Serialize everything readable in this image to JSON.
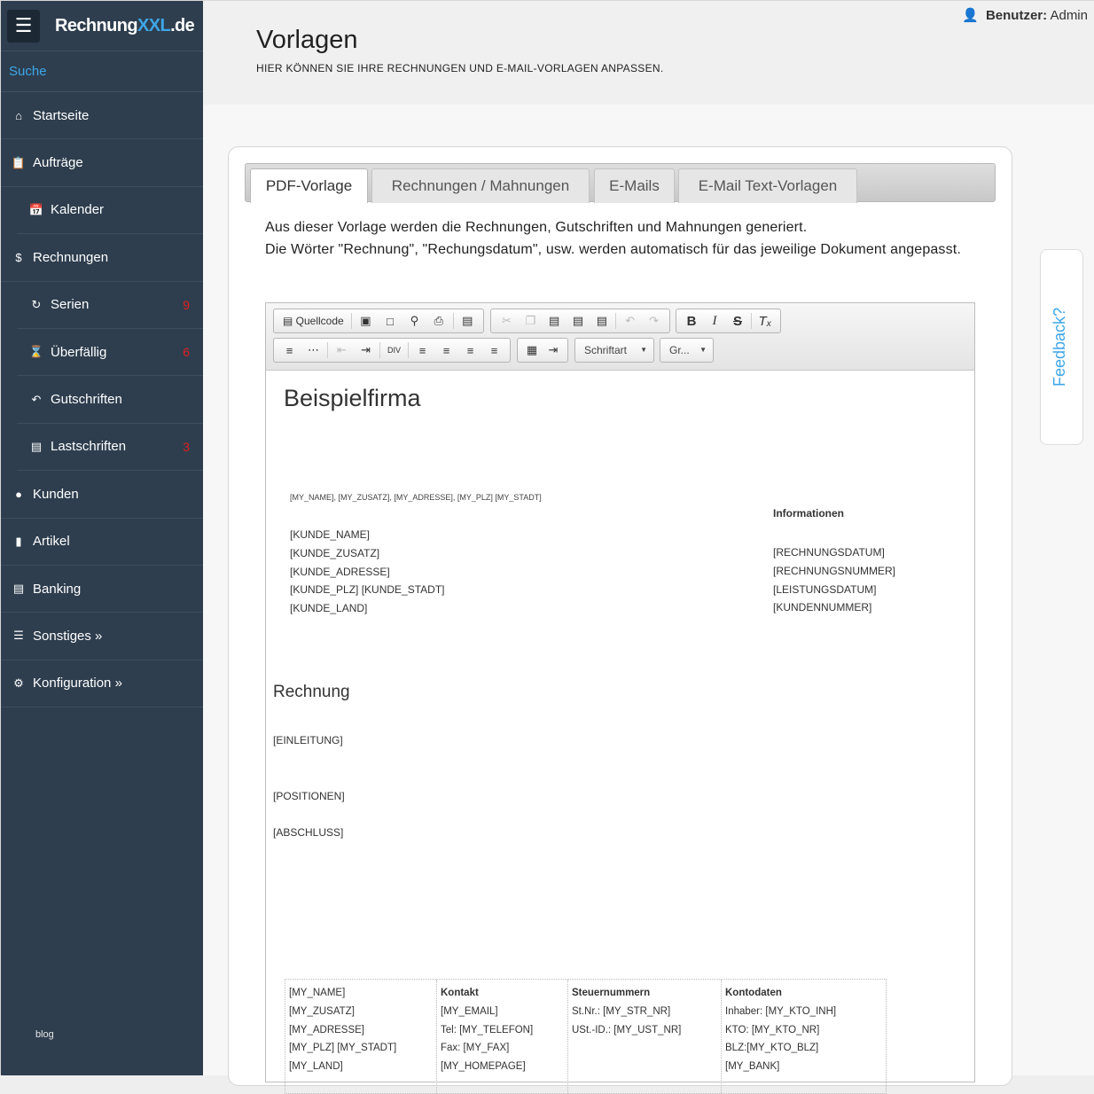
{
  "app": {
    "logo_main": "Rechnung",
    "logo_accent": "XXL",
    "logo_tld": ".de",
    "menu_icon": "hamburger-icon"
  },
  "sidebar": {
    "search_label": "Suche",
    "items": [
      {
        "label": "Startseite",
        "icon": "home-icon",
        "badge": ""
      },
      {
        "label": "Aufträge",
        "icon": "clipboard-icon",
        "badge": ""
      },
      {
        "label": "Kalender",
        "icon": "calendar-icon",
        "badge": ""
      },
      {
        "label": "Rechnungen",
        "icon": "dollar-circle-icon",
        "badge": ""
      },
      {
        "label": "Serien",
        "icon": "refresh-icon",
        "badge": "9"
      },
      {
        "label": "Überfällig",
        "icon": "hourglass-icon",
        "badge": "6"
      },
      {
        "label": "Gutschriften",
        "icon": "undo-icon",
        "badge": ""
      },
      {
        "label": "Lastschriften",
        "icon": "credit-card-icon",
        "badge": "3"
      },
      {
        "label": "Kunden",
        "icon": "user-icon",
        "badge": ""
      },
      {
        "label": "Artikel",
        "icon": "barcode-icon",
        "badge": ""
      },
      {
        "label": "Banking",
        "icon": "card-icon",
        "badge": ""
      },
      {
        "label": "Sonstiges »",
        "icon": "list-icon",
        "badge": ""
      },
      {
        "label": "Konfiguration »",
        "icon": "gear-icon",
        "badge": ""
      }
    ],
    "footer_link": "blog"
  },
  "user": {
    "label": "Benutzer:",
    "name": "Admin"
  },
  "header": {
    "title": "Vorlagen",
    "subtitle": "HIER KÖNNEN SIE IHRE RECHNUNGEN UND E-MAIL-VORLAGEN ANPASSEN."
  },
  "tabs": [
    {
      "label": "PDF-Vorlage",
      "active": true
    },
    {
      "label": "Rechnungen / Mahnungen",
      "active": false
    },
    {
      "label": "E-Mails",
      "active": false
    },
    {
      "label": "E-Mail Text-Vorlagen",
      "active": false
    }
  ],
  "intro": {
    "line1": "Aus dieser Vorlage werden die Rechnungen, Gutschriften und Mahnungen generiert.",
    "line2": "Die Wörter \"Rechnung\", \"Rechungsdatum\", usw. werden automatisch für das jeweilige Dokument angepasst."
  },
  "toolbar": {
    "source_label": "Quellcode",
    "font_label": "Schriftart",
    "size_label": "Gr..."
  },
  "document": {
    "firm": "Beispielfirma",
    "sender_line": "[MY_NAME], [MY_ZUSATZ], [MY_ADRESSE], [MY_PLZ] [MY_STADT]",
    "address": [
      "[KUNDE_NAME]",
      "[KUNDE_ZUSATZ]",
      "[KUNDE_ADRESSE]",
      "[KUNDE_PLZ] [KUNDE_STADT]",
      "[KUNDE_LAND]"
    ],
    "info_heading": "Informationen",
    "info": [
      "[RECHNUNGSDATUM]",
      "[RECHNUNGSNUMMER]",
      "[LEISTUNGSDATUM]",
      "[KUNDENNUMMER]"
    ],
    "doc_title": "Rechnung",
    "intro_placeholder": "[EINLEITUNG]",
    "positions_placeholder": "[POSITIONEN]",
    "closing_placeholder": "[ABSCHLUSS]",
    "footer": {
      "col1": [
        "[MY_NAME]",
        "[MY_ZUSATZ]",
        "[MY_ADRESSE]",
        "[MY_PLZ] [MY_STADT]",
        "[MY_LAND]"
      ],
      "col2_heading": "Kontakt",
      "col2": [
        "[MY_EMAIL]",
        "Tel: [MY_TELEFON]",
        "Fax: [MY_FAX]",
        "[MY_HOMEPAGE]"
      ],
      "col3_heading": "Steuernummern",
      "col3": [
        "St.Nr.: [MY_STR_NR]",
        "USt.-ID.: [MY_UST_NR]"
      ],
      "col4_heading": "Kontodaten",
      "col4": [
        "Inhaber: [MY_KTO_INH]",
        "KTO: [MY_KTO_NR]",
        "BLZ:[MY_KTO_BLZ]",
        "[MY_BANK]"
      ]
    }
  },
  "feedback_label": "Feedback?",
  "colors": {
    "sidebar_bg": "#2e3e4e",
    "accent": "#3ea6e8",
    "badge": "#e02020"
  }
}
